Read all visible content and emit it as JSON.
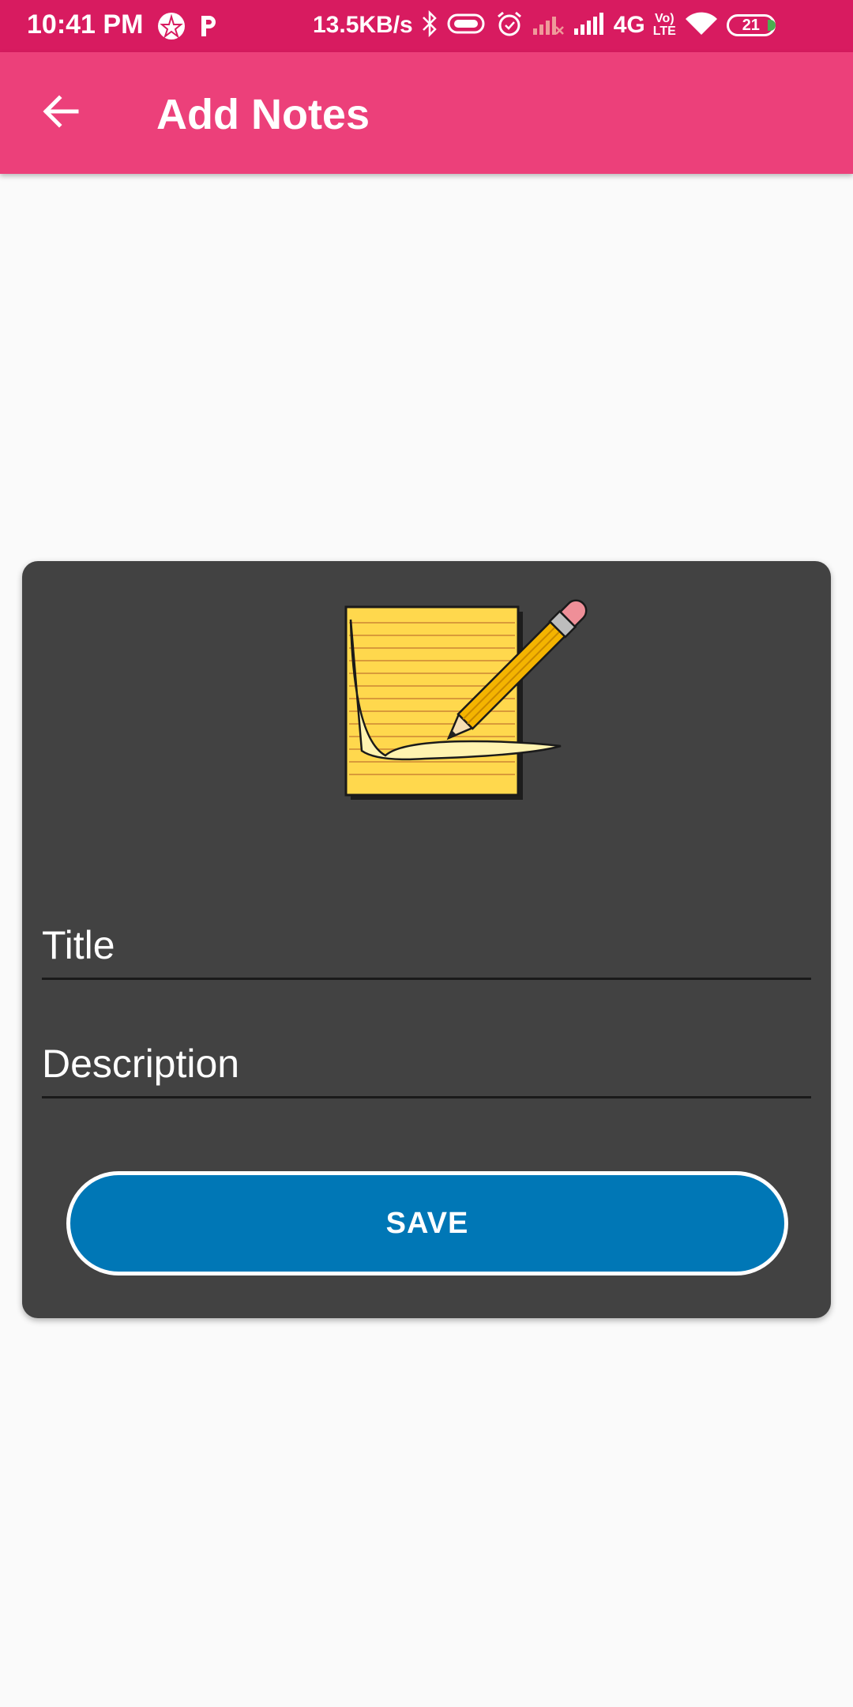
{
  "status_bar": {
    "time": "10:41 PM",
    "net_speed": "13.5KB/s",
    "network": "4G",
    "volte_top": "Vo)",
    "volte_bottom": "LTE",
    "battery": "21"
  },
  "app_bar": {
    "title": "Add Notes",
    "back_icon": "arrow-back-icon"
  },
  "form": {
    "image_icon": "notepad-pencil-icon",
    "title_placeholder": "Title",
    "description_placeholder": "Description",
    "save_label": "SAVE"
  },
  "colors": {
    "status_bar": "#d81b60",
    "app_bar": "#ec407a",
    "card": "#424242",
    "save_button": "#0077b6",
    "background": "#fafafa"
  }
}
